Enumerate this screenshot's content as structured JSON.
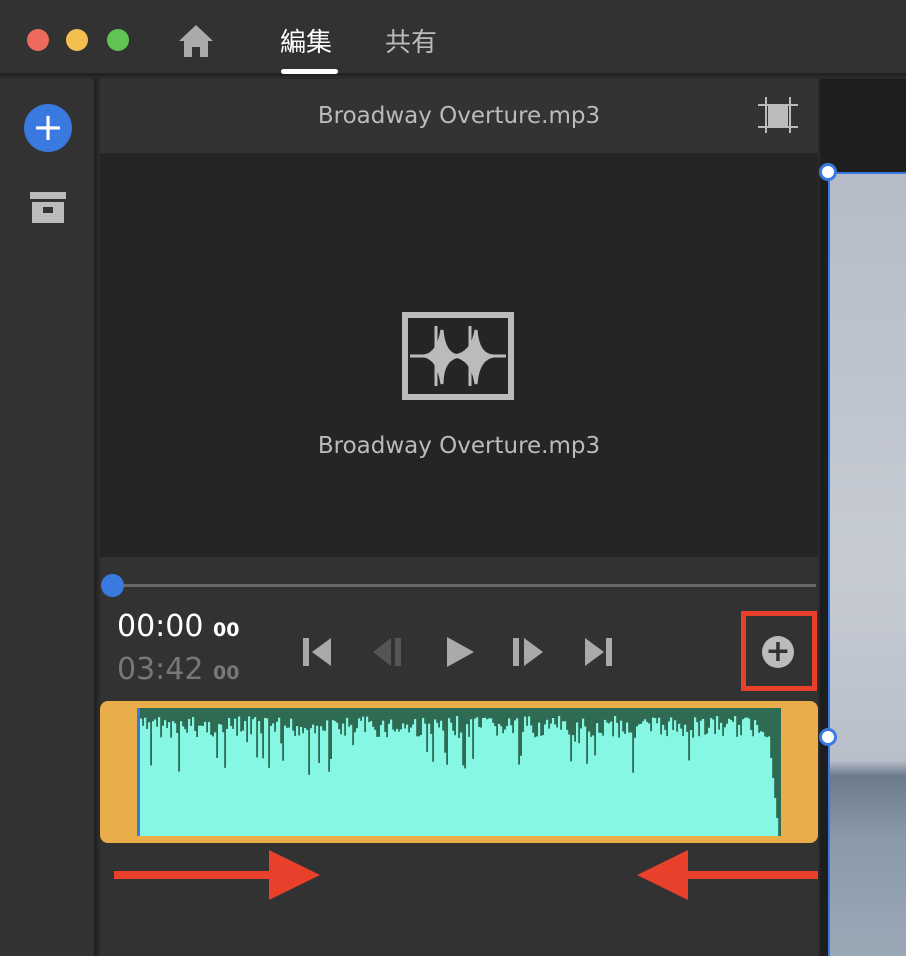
{
  "tabs": [
    {
      "label": "編集",
      "active": true
    },
    {
      "label": "共有",
      "active": false
    }
  ],
  "media": {
    "filename_header": "Broadway Overture.mp3",
    "filename_preview": "Broadway Overture.mp3"
  },
  "player": {
    "current_time": "00:00",
    "current_frames": "00",
    "duration": "03:42",
    "duration_frames": "00",
    "progress": 0
  },
  "colors": {
    "accent": "#3a7ae0",
    "trim": "#e9ad4a",
    "wave": "#86f7e2",
    "wave_bg": "#2f6a52",
    "annotation": "#e8402a"
  }
}
